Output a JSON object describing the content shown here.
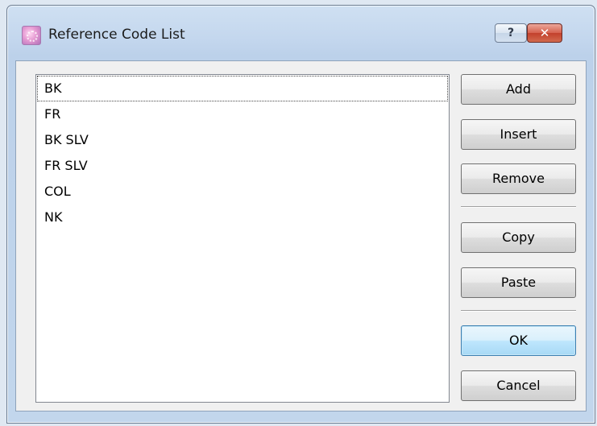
{
  "window": {
    "title": "Reference Code List",
    "help_button": "?",
    "close_button": "✕"
  },
  "list": {
    "items": [
      "BK",
      "FR",
      "BK SLV",
      "FR SLV",
      "COL",
      "NK"
    ],
    "selected_index": 0
  },
  "buttons": {
    "add": "Add",
    "insert": "Insert",
    "remove": "Remove",
    "copy": "Copy",
    "paste": "Paste",
    "ok": "OK",
    "cancel": "Cancel"
  }
}
